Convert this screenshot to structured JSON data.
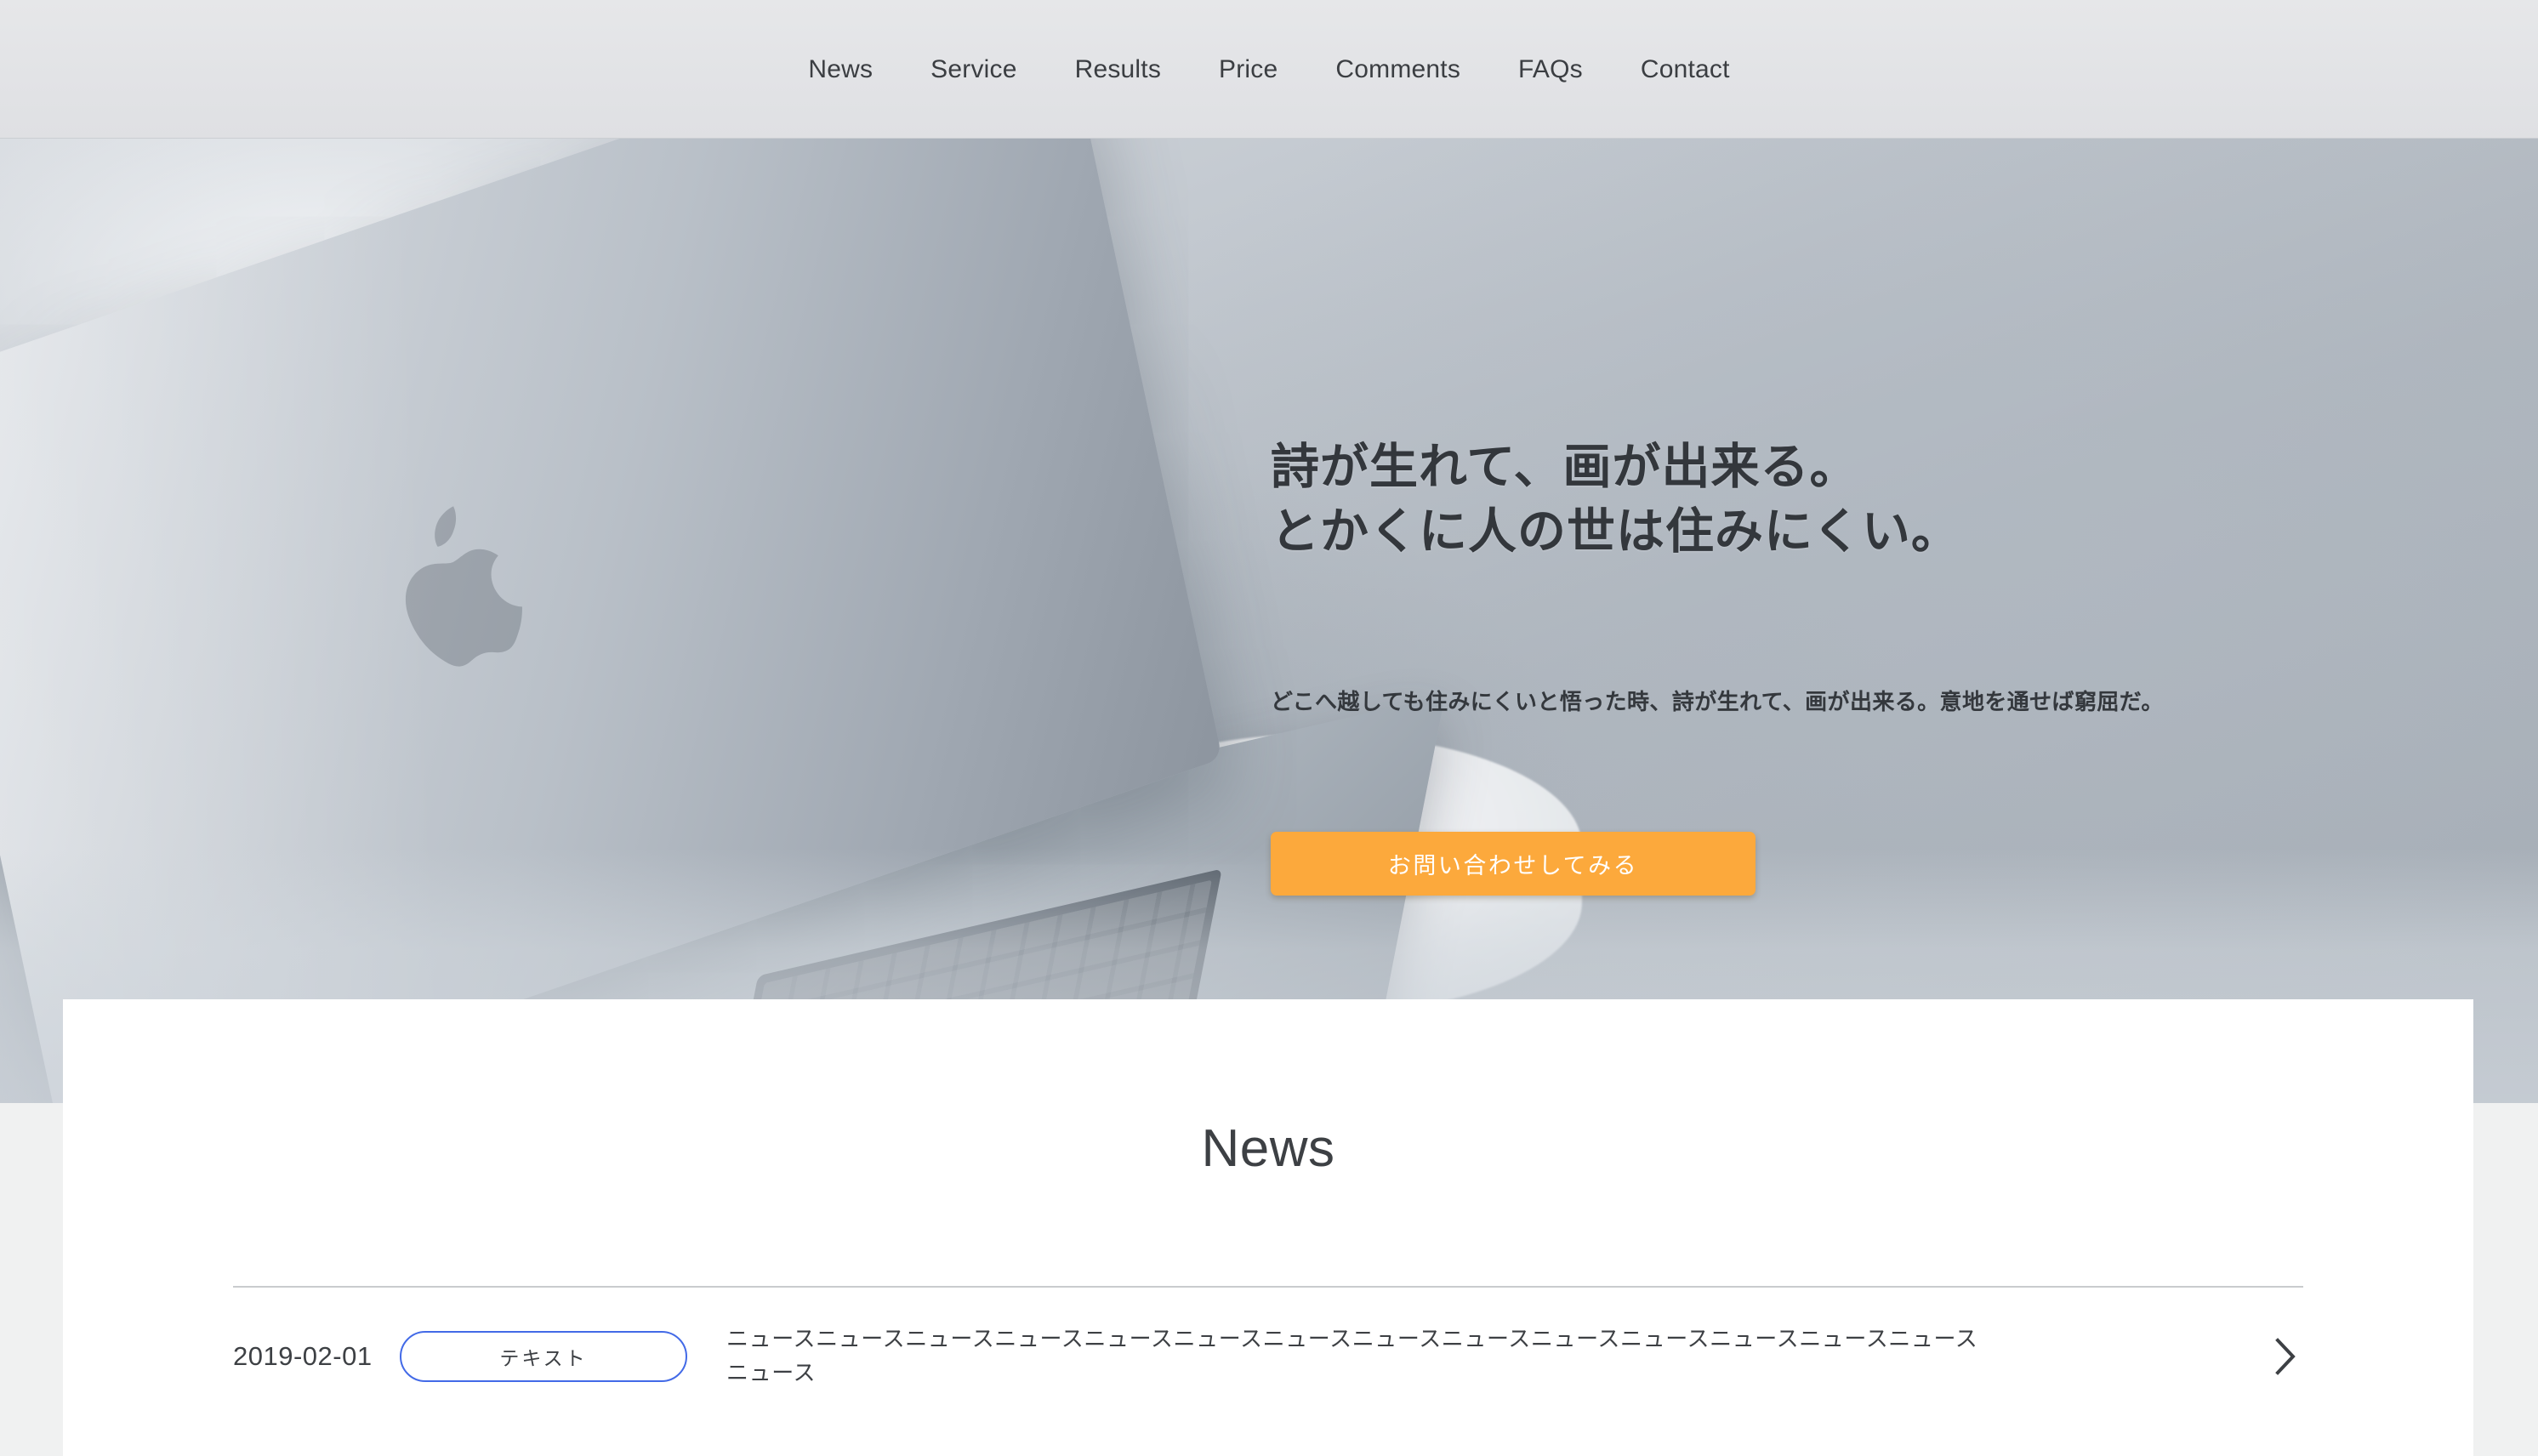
{
  "theme": {
    "accent_orange": "#fca93c",
    "tag_blue": "#436ae7",
    "text_dark": "#3d4044",
    "header_bg": "#e2e3e6",
    "card_bg": "#ffffff",
    "page_bg": "#f0f1f1"
  },
  "header": {
    "nav": [
      {
        "label": "News"
      },
      {
        "label": "Service"
      },
      {
        "label": "Results"
      },
      {
        "label": "Price"
      },
      {
        "label": "Comments"
      },
      {
        "label": "FAQs"
      },
      {
        "label": "Contact"
      }
    ]
  },
  "hero": {
    "title_line1": "詩が生れて、画が出来る。",
    "title_line2": "とかくに人の世は住みにくい。",
    "lede": "どこへ越しても住みにくいと悟った時、詩が生れて、画が出来る。意地を通せば窮屈だ。",
    "cta_label": "お問い合わせしてみる",
    "image_alt": "macbook-laptop-photo"
  },
  "news": {
    "heading": "News",
    "items": [
      {
        "date": "2019-02-01",
        "tag": "テキスト",
        "text": "ニュースニュースニュースニュースニュースニュースニュースニュースニュースニュースニュースニュースニュースニュースニュース",
        "chevron": "chevron-right-icon"
      }
    ]
  }
}
